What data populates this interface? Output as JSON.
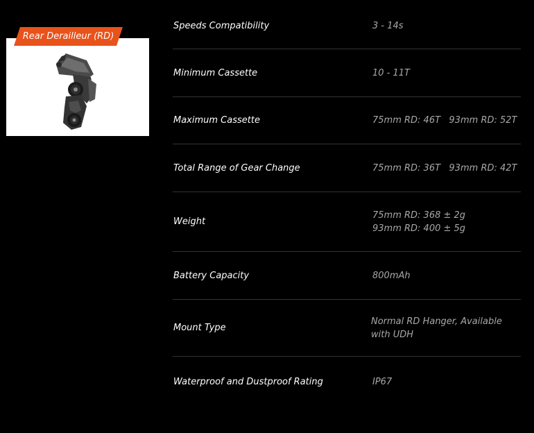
{
  "product": {
    "tag_label": "Rear Derailleur (RD)",
    "image_name": "rear-derailleur"
  },
  "colors": {
    "background": "#000000",
    "accent": "#e8521b",
    "label_text": "#ffffff",
    "value_text": "#a8a8a8",
    "divider": "#333333"
  },
  "specs": [
    {
      "label": "Speeds Compatibility",
      "value": [
        "3 - 14s"
      ]
    },
    {
      "label": "Minimum Cassette",
      "value": [
        "10 - 11T"
      ]
    },
    {
      "label": "Maximum Cassette",
      "value": [
        "75mm RD: 46T   93mm RD: 52T"
      ]
    },
    {
      "label": "Total Range of Gear Change",
      "value": [
        "75mm RD: 36T   93mm RD: 42T"
      ]
    },
    {
      "label": "Weight",
      "value": [
        "75mm RD: 368 ± 2g",
        "93mm RD: 400 ± 5g"
      ]
    },
    {
      "label": "Battery Capacity",
      "value": [
        "800mAh"
      ]
    },
    {
      "label": "Mount Type",
      "value": [
        "Normal RD Hanger, Available with UDH"
      ]
    },
    {
      "label": "Waterproof and Dustproof Rating",
      "value": [
        "IP67"
      ]
    }
  ]
}
